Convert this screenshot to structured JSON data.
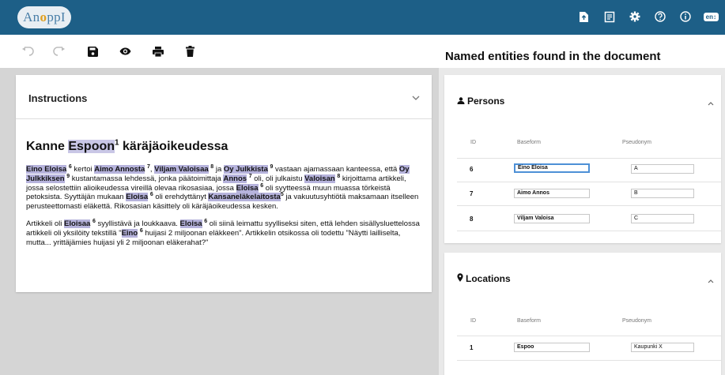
{
  "app": {
    "logo_text_a": "An",
    "logo_text_o": "o",
    "logo_text_b": "ppI"
  },
  "topbar_icons": [
    "export-icon",
    "document-list-icon",
    "settings-gear-icon",
    "help-icon",
    "info-icon"
  ],
  "language": {
    "selected": "en"
  },
  "toolbar": {
    "icons": [
      "undo-icon",
      "redo-icon",
      "save-icon",
      "preview-eye-icon",
      "print-icon",
      "delete-trash-icon"
    ]
  },
  "instructions": {
    "title": "Instructions"
  },
  "document": {
    "title_pre": "Kanne ",
    "title_entity": "Espoon",
    "title_sup": "1",
    "title_post": " käräjäoikeudessa",
    "p1": {
      "e1": "Eino Eloisa",
      "s1": "6",
      "t1": " kertoi ",
      "e2": "Aimo Annosta",
      "s2": "7",
      "t2": ", ",
      "e3": "Viljam Valoisaa",
      "s3": "8",
      "t3": " ja ",
      "e4": "Oy Julkkista",
      "s4": "9",
      "t4": " vastaan ajamassaan kanteessa, että ",
      "e5": "Oy Julkkiksen",
      "s5": "9",
      "t5": " kustantamassa lehdessä, jonka päätoimittaja ",
      "e6": "Annos",
      "s6": "7",
      "t6": " oli, oli julkaistu ",
      "e7": "Valoisan",
      "s7": "8",
      "t7": " kirjoittama artikkeli, jossa selostettiin alioikeudessa vireillä olevaa rikosasiaa, jossa ",
      "e8": "Eloisa",
      "s8": "6",
      "t8": " oli syytteessä muun muassa törkeistä petoksista. Syyttäjän mukaan ",
      "e9": "Eloisa",
      "s9": "6",
      "t9": " oli erehdyttänyt ",
      "e10": "Kansaneläkelaitosta",
      "s10": "5",
      "t10": " ja vakuutusyhtiötä maksamaan itselleen perusteettomasti eläkettä. Rikosasian käsittely oli käräjäoikeudessa kesken."
    },
    "p2": {
      "t0": "Artikkeli oli ",
      "e1": "Eloisaa",
      "s1": "6",
      "t1": " syyllistävä ja loukkaava. ",
      "e2": "Eloisa",
      "s2": "6",
      "t2": " oli siinä leimattu syylliseksi siten, että lehden sisällysluettelossa artikkeli oli yksilöity tekstillä \"",
      "e3": "Eino",
      "s3": "6",
      "t3": " huijasi 2 miljoonan eläkkeen\". Artikkelin otsikossa oli todettu \"Näytti lailliselta, mutta... yrittäjämies huijasi yli 2 miljoonan eläkerahat?\""
    }
  },
  "entities_panel": {
    "title": "Named entities found in the document",
    "persons": {
      "title": "Persons",
      "headers": {
        "id": "ID",
        "baseform": "Baseform",
        "pseudonym": "Pseudonym"
      },
      "rows": [
        {
          "id": "6",
          "baseform": "Eino Eloisa",
          "pseudonym": "A"
        },
        {
          "id": "7",
          "baseform": "Aimo Annos",
          "pseudonym": "B"
        },
        {
          "id": "8",
          "baseform": "Viljam Valoisa",
          "pseudonym": "C"
        }
      ]
    },
    "locations": {
      "title": "Locations",
      "headers": {
        "id": "ID",
        "baseform": "Baseform",
        "pseudonym": "Pseudonym"
      },
      "rows": [
        {
          "id": "1",
          "baseform": "Espoo",
          "pseudonym": "Kaupunki X"
        }
      ]
    }
  },
  "colors": {
    "topbar": "#1d5f87",
    "entity_highlight": "#b6b3dc",
    "focus": "#4d90d6"
  }
}
